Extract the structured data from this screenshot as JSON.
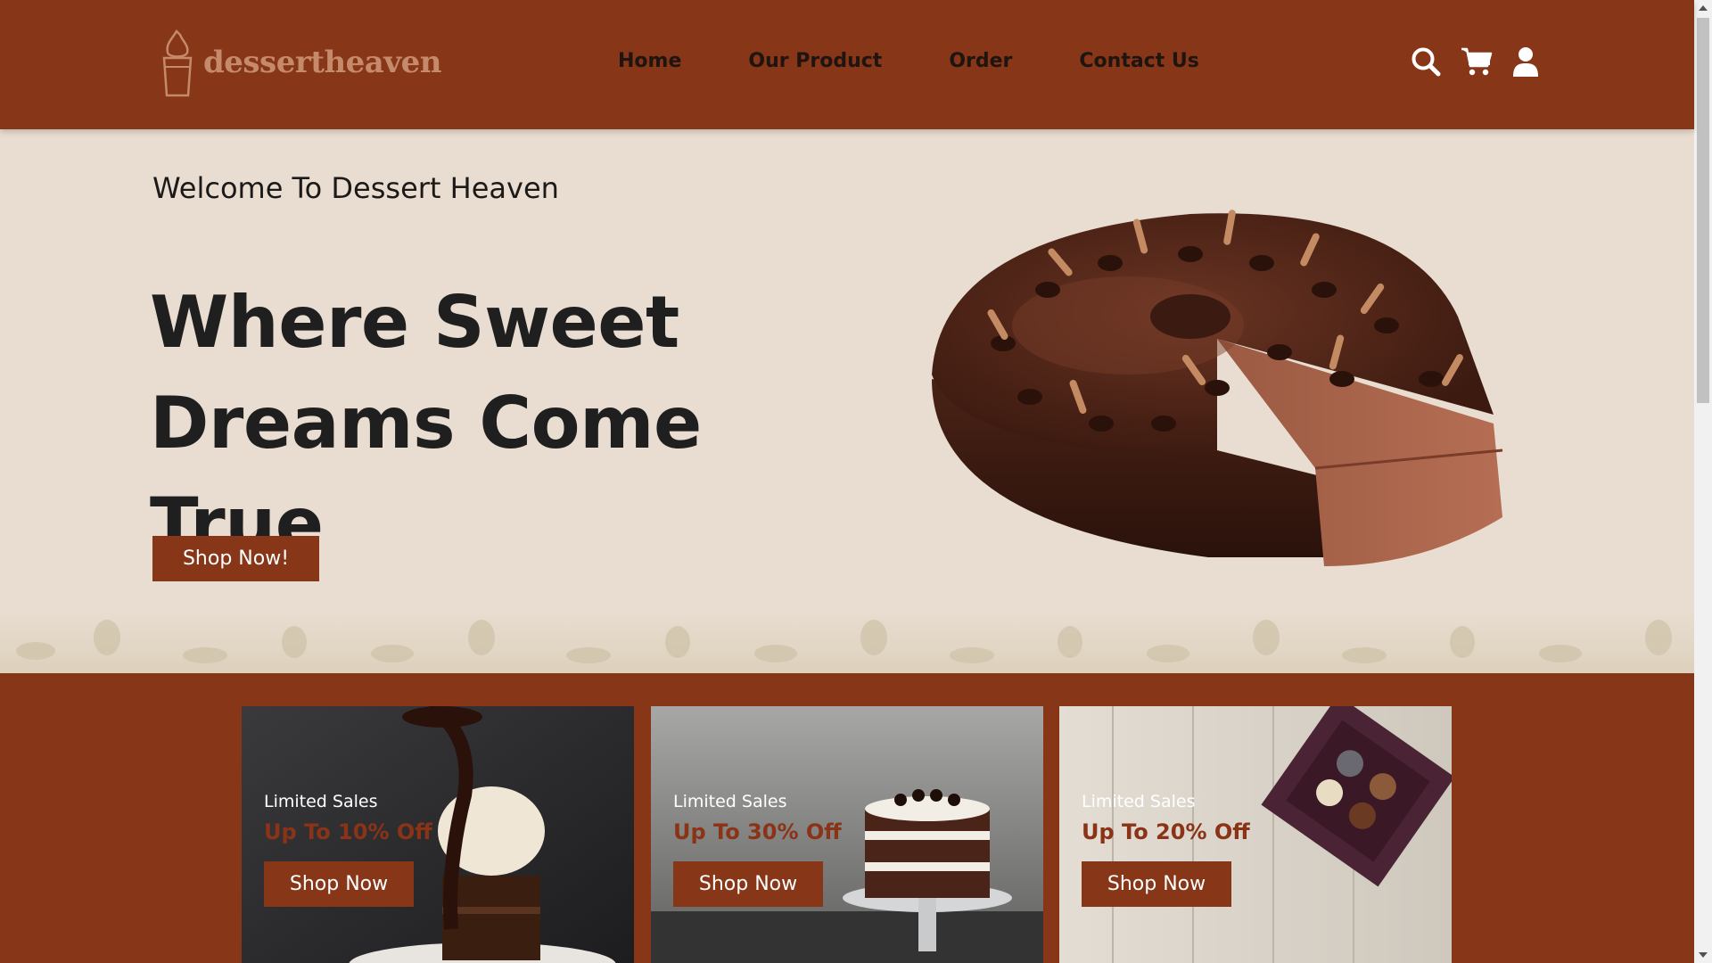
{
  "brand": {
    "name": "dessertheaven"
  },
  "nav": {
    "items": [
      "Home",
      "Our Product",
      "Order",
      "Contact Us"
    ]
  },
  "nav_icons": [
    "search-icon",
    "cart-icon",
    "user-icon"
  ],
  "hero": {
    "welcome": "Welcome To Dessert Heaven",
    "headline_line1": "Where Sweet",
    "headline_line2": "Dreams Come True",
    "button": "Shop Now!"
  },
  "promos": [
    {
      "label": "Limited Sales",
      "offer": "Up To 10% Off",
      "button": "Shop Now"
    },
    {
      "label": "Limited Sales",
      "offer": "Up To 30% Off",
      "button": "Shop Now"
    },
    {
      "label": "Limited Sales",
      "offer": "Up To 20% Off",
      "button": "Shop Now"
    }
  ],
  "colors": {
    "brand": "#873618",
    "hero_bg": "#e8ddd0",
    "text_dark": "#1f1f1f",
    "offer": "#8b3317"
  }
}
